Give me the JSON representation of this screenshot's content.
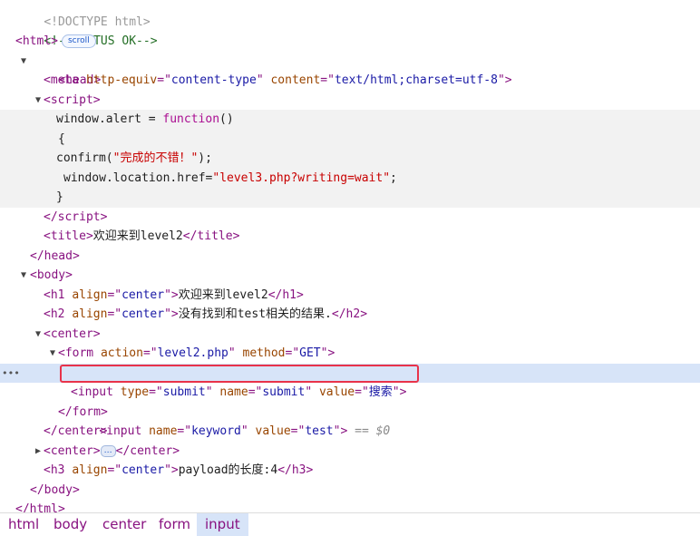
{
  "doc": {
    "doctype": "<!DOCTYPE html>",
    "comment": "<!--STATUS OK-->",
    "html_tag": "html",
    "scroll_badge": "scroll",
    "head_tag": "head",
    "meta": {
      "tag": "meta",
      "attr1": "http-equiv",
      "val1": "content-type",
      "attr2": "content",
      "val2": "text/html;charset=utf-8"
    },
    "script_tag": "script",
    "script_lines": {
      "l1a": "window.alert = ",
      "l1b": "function",
      "l1c": "()",
      "l2": "{",
      "l3a": "confirm(",
      "l3b": "\"完成的不错！\"",
      "l3c": ");",
      "l4a": "window.location.href=",
      "l4b": "\"level3.php?writing=wait\"",
      "l4c": ";",
      "l5": "}"
    },
    "title_tag": "title",
    "title_text": "欢迎来到level2",
    "body_tag": "body",
    "h1": {
      "tag": "h1",
      "attr": "align",
      "val": "center",
      "text": "欢迎来到level2"
    },
    "h2": {
      "tag": "h2",
      "attr": "align",
      "val": "center",
      "text": "没有找到和test相关的结果."
    },
    "center_tag": "center",
    "form": {
      "tag": "form",
      "attr1": "action",
      "val1": "level2.php",
      "attr2": "method",
      "val2": "GET"
    },
    "input1": {
      "tag": "input",
      "attr1": "name",
      "val1": "keyword",
      "attr2": "value",
      "val2": "test",
      "ref": "== $0"
    },
    "input2": {
      "tag": "input",
      "attr1": "type",
      "val1": "submit",
      "attr2": "name",
      "val2": "submit",
      "attr3": "value",
      "val3": "搜索"
    },
    "ellipsis": "…",
    "h3": {
      "tag": "h3",
      "attr": "align",
      "val": "center",
      "text": "payload的长度:4"
    }
  },
  "breadcrumbs": [
    "html",
    "body",
    "center",
    "form",
    "input"
  ],
  "colors": {
    "tag": "#881280",
    "attr": "#994500",
    "value": "#1a1aa6",
    "selected_bg": "#d7e4f8",
    "highlight_border": "#e8334a"
  }
}
